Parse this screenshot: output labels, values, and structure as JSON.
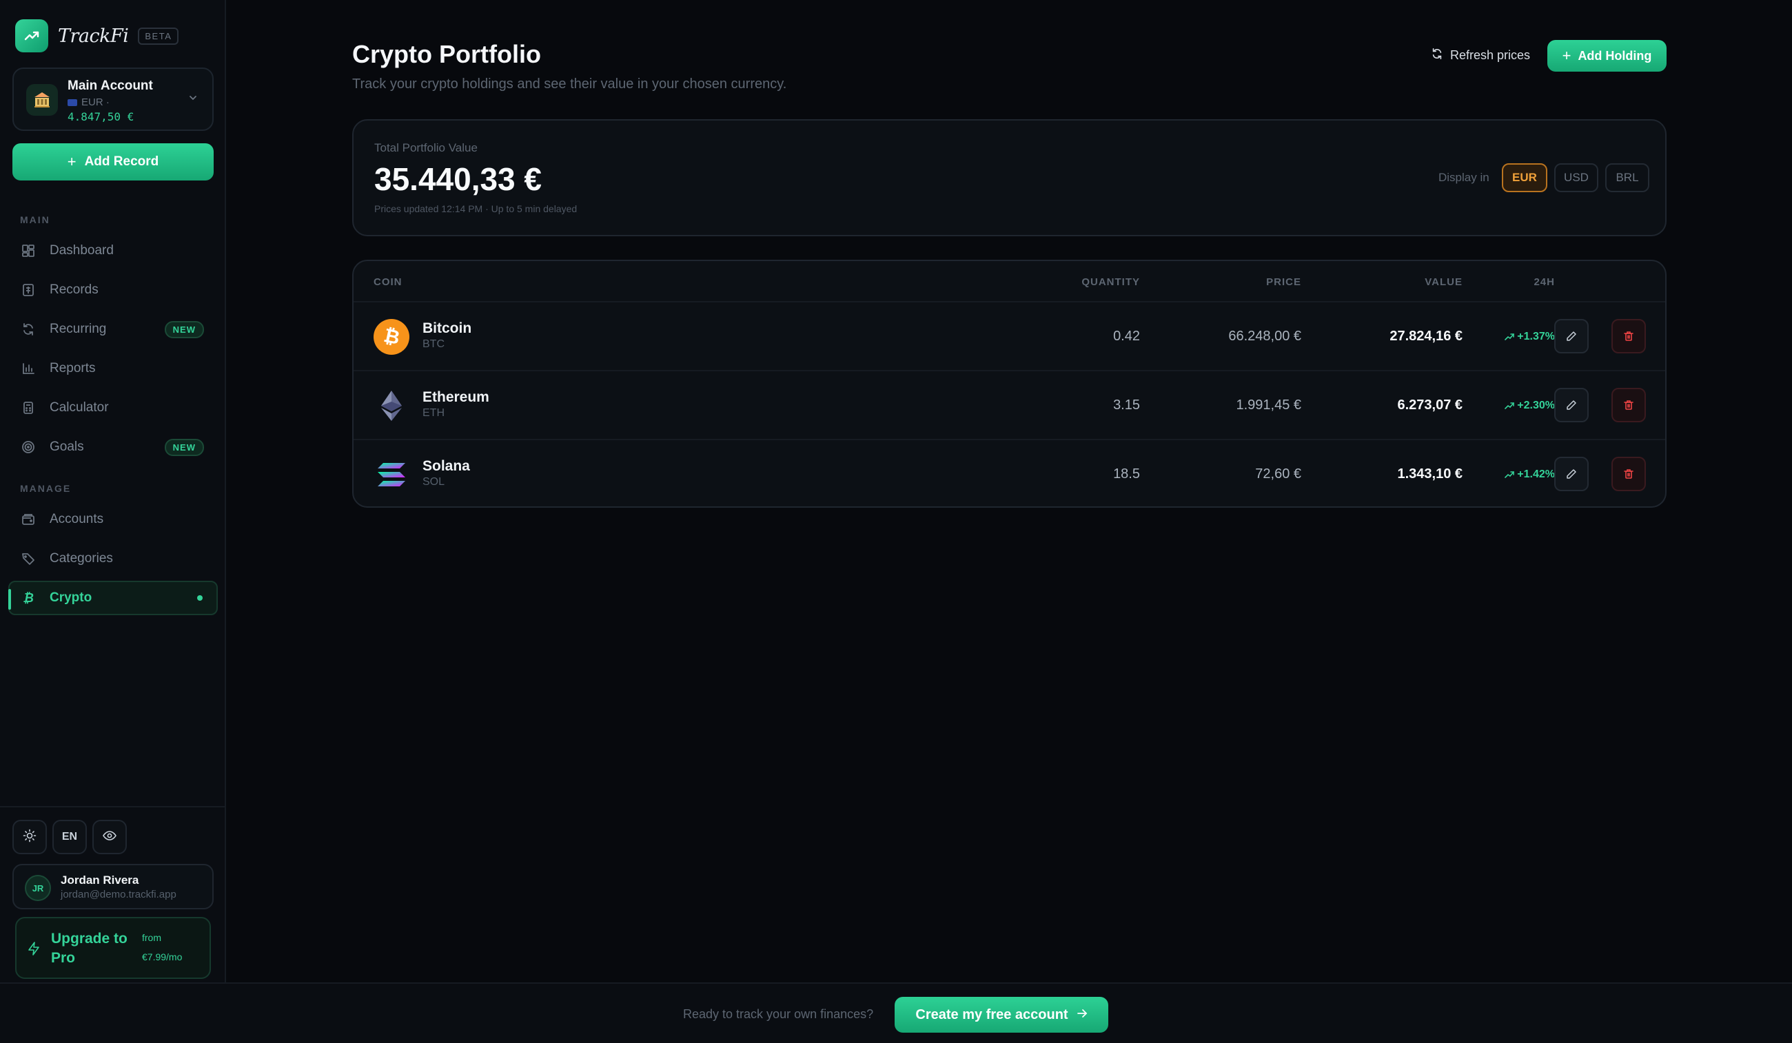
{
  "brand": {
    "name": "TrackFi",
    "badge": "BETA",
    "accent": "#34d399"
  },
  "account": {
    "name": "Main Account",
    "currency": "EUR ·",
    "balance": "4.847,50 €"
  },
  "sidebar": {
    "add_record": "Add Record",
    "sections": {
      "main": "MAIN",
      "manage": "MANAGE"
    },
    "main_items": [
      {
        "label": "Dashboard",
        "icon": "dashboard-icon"
      },
      {
        "label": "Records",
        "icon": "records-icon"
      },
      {
        "label": "Recurring",
        "icon": "recurring-icon",
        "badge": "NEW"
      },
      {
        "label": "Reports",
        "icon": "reports-icon"
      },
      {
        "label": "Calculator",
        "icon": "calculator-icon"
      },
      {
        "label": "Goals",
        "icon": "goals-icon",
        "badge": "NEW"
      }
    ],
    "manage_items": [
      {
        "label": "Accounts",
        "icon": "wallet-icon"
      },
      {
        "label": "Categories",
        "icon": "tag-icon"
      },
      {
        "label": "Crypto",
        "icon": "bitcoin-icon",
        "active": true
      }
    ],
    "language": "EN"
  },
  "user": {
    "initials": "JR",
    "name": "Jordan Rivera",
    "email": "jordan@demo.trackfi.app"
  },
  "upgrade": {
    "title": "Upgrade to Pro",
    "from": "from",
    "price": "€7.99/mo"
  },
  "header": {
    "title": "Crypto Portfolio",
    "subtitle": "Track your crypto holdings and see their value in your chosen currency.",
    "refresh": "Refresh prices",
    "add_holding": "Add Holding"
  },
  "summary": {
    "label": "Total Portfolio Value",
    "value": "35.440,33 €",
    "note": "Prices updated 12:14 PM · Up to 5 min delayed",
    "display_in": "Display in",
    "currencies": [
      "EUR",
      "USD",
      "BRL"
    ],
    "selected_currency": "EUR"
  },
  "table": {
    "headers": {
      "coin": "COIN",
      "quantity": "QUANTITY",
      "price": "PRICE",
      "value": "VALUE",
      "change": "24H"
    },
    "rows": [
      {
        "name": "Bitcoin",
        "symbol": "BTC",
        "quantity": "0.42",
        "price": "66.248,00 €",
        "value": "27.824,16 €",
        "change": "+1.37%"
      },
      {
        "name": "Ethereum",
        "symbol": "ETH",
        "quantity": "3.15",
        "price": "1.991,45 €",
        "value": "6.273,07 €",
        "change": "+2.30%"
      },
      {
        "name": "Solana",
        "symbol": "SOL",
        "quantity": "18.5",
        "price": "72,60 €",
        "value": "1.343,10 €",
        "change": "+1.42%"
      }
    ]
  },
  "footer": {
    "text": "Ready to track your own finances?",
    "cta": "Create my free account"
  }
}
